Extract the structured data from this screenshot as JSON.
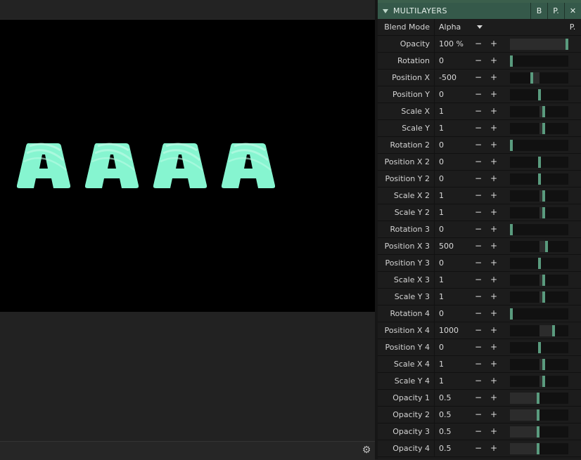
{
  "panel": {
    "title": "MULTILAYERS",
    "header_buttons": [
      "B",
      "P.",
      "✕"
    ],
    "blend": {
      "label": "Blend Mode",
      "value": "Alpha",
      "button": "P."
    },
    "params": [
      {
        "label": "Opacity",
        "value": "100 %",
        "level": 1.0,
        "center": false
      },
      {
        "label": "Rotation",
        "value": "0",
        "level": 0.0,
        "center": false
      },
      {
        "label": "Position X",
        "value": "-500",
        "level": -0.25,
        "center": true
      },
      {
        "label": "Position Y",
        "value": "0",
        "level": 0.0,
        "center": true
      },
      {
        "label": "Scale X",
        "value": "1",
        "level": 0.15,
        "center": true
      },
      {
        "label": "Scale Y",
        "value": "1",
        "level": 0.15,
        "center": true
      },
      {
        "label": "Rotation 2",
        "value": "0",
        "level": 0.0,
        "center": false
      },
      {
        "label": "Position X 2",
        "value": "0",
        "level": 0.0,
        "center": true
      },
      {
        "label": "Position Y 2",
        "value": "0",
        "level": 0.0,
        "center": true
      },
      {
        "label": "Scale X 2",
        "value": "1",
        "level": 0.15,
        "center": true
      },
      {
        "label": "Scale Y 2",
        "value": "1",
        "level": 0.15,
        "center": true
      },
      {
        "label": "Rotation 3",
        "value": "0",
        "level": 0.0,
        "center": false
      },
      {
        "label": "Position X 3",
        "value": "500",
        "level": 0.25,
        "center": true
      },
      {
        "label": "Position Y 3",
        "value": "0",
        "level": 0.0,
        "center": true
      },
      {
        "label": "Scale X 3",
        "value": "1",
        "level": 0.15,
        "center": true
      },
      {
        "label": "Scale Y 3",
        "value": "1",
        "level": 0.15,
        "center": true
      },
      {
        "label": "Rotation 4",
        "value": "0",
        "level": 0.0,
        "center": false
      },
      {
        "label": "Position X 4",
        "value": "1000",
        "level": 0.5,
        "center": true
      },
      {
        "label": "Position Y 4",
        "value": "0",
        "level": 0.0,
        "center": true
      },
      {
        "label": "Scale X 4",
        "value": "1",
        "level": 0.15,
        "center": true
      },
      {
        "label": "Scale Y 4",
        "value": "1",
        "level": 0.15,
        "center": true
      },
      {
        "label": "Opacity 1",
        "value": "0.5",
        "level": 0.5,
        "center": false
      },
      {
        "label": "Opacity 2",
        "value": "0.5",
        "level": 0.5,
        "center": false
      },
      {
        "label": "Opacity 3",
        "value": "0.5",
        "level": 0.5,
        "center": false
      },
      {
        "label": "Opacity 4",
        "value": "0.5",
        "level": 0.5,
        "center": false
      }
    ]
  },
  "preview": {
    "letters": [
      "A",
      "A",
      "A",
      "A"
    ],
    "letter_color": "#86f5d0",
    "stripe_color": "#b9fbe4"
  },
  "colors": {
    "accent": "#5a9b7e",
    "header": "#35594a"
  },
  "icons": {
    "statusbar": "gear-icon"
  }
}
